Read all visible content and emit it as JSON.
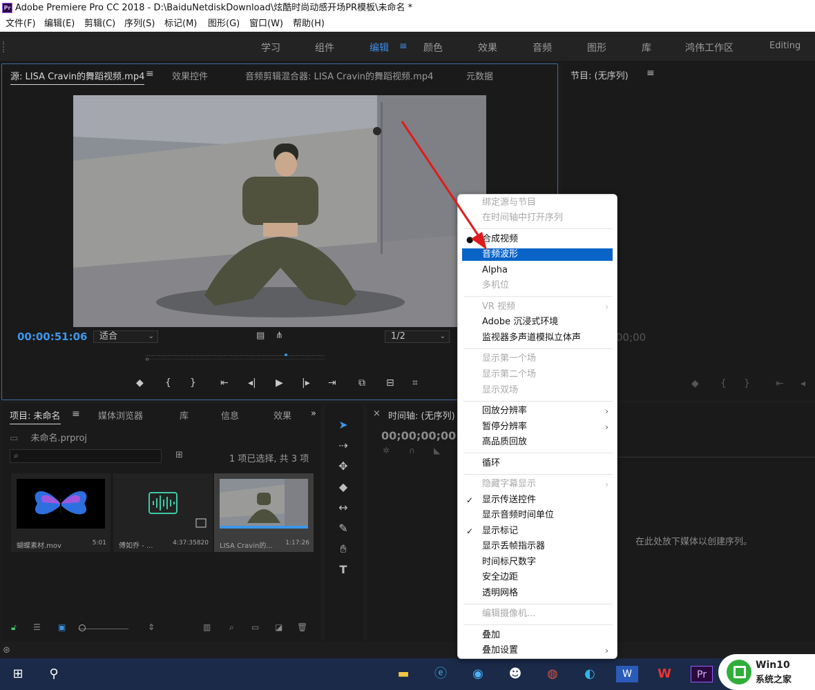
{
  "window": {
    "title": "Adobe Premiere Pro CC 2018 - D:\\BaiduNetdiskDownload\\炫酷时尚动感开场PR模板\\未命名 *"
  },
  "menubar": [
    "文件(F)",
    "编辑(E)",
    "剪辑(C)",
    "序列(S)",
    "标记(M)",
    "图形(G)",
    "窗口(W)",
    "帮助(H)"
  ],
  "workspaces": {
    "items": [
      "学习",
      "组件",
      "编辑",
      "颜色",
      "效果",
      "音频",
      "图形",
      "库",
      "鸿伟工作区",
      "Editing"
    ],
    "active": "编辑",
    "menu_icon": "≡"
  },
  "source_panel": {
    "tabs": [
      "源: LISA Cravin的舞蹈视频.mp4",
      "效果控件",
      "音频剪辑混合器: LISA Cravin的舞蹈视频.mp4",
      "元数据"
    ],
    "menu_icon": "≡",
    "timecode": "00:00:51:06",
    "fit_label": "适合",
    "resolution": "1/2"
  },
  "program_panel": {
    "title": "节目: (无序列)",
    "menu_icon": "≡",
    "timecode": "00;00"
  },
  "project_panel": {
    "tabs": [
      "项目: 未命名",
      "媒体浏览器",
      "库",
      "信息",
      "效果"
    ],
    "menu_icon": "≡",
    "expand_icon": "»",
    "path": "未命名.prproj",
    "selection_count": "1 项已选择, 共 3 项",
    "clips": [
      {
        "name": "蝴蝶素材.mov",
        "duration": "5:01"
      },
      {
        "name": "傅如乔 - ...",
        "duration": "4:37:35820"
      },
      {
        "name": "LISA Cravin的...",
        "duration": "1:17:26"
      }
    ]
  },
  "timeline_panel": {
    "close_icon": "×",
    "title": "时间轴: (无序列)",
    "timecode": "00;00;00;00",
    "drop_hint": "在此处放下媒体以创建序列。"
  },
  "context_menu": {
    "items": [
      {
        "label": "绑定源与节目",
        "disabled": true
      },
      {
        "label": "在时间轴中打开序列",
        "disabled": true
      },
      {
        "separator": true
      },
      {
        "label": "合成视频",
        "bullet": true
      },
      {
        "label": "音频波形",
        "highlight": true
      },
      {
        "label": "Alpha"
      },
      {
        "label": "多机位",
        "disabled": true
      },
      {
        "separator": true
      },
      {
        "label": "VR 视频",
        "disabled": true,
        "submenu": true
      },
      {
        "label": "Adobe 沉浸式环境"
      },
      {
        "label": "监视器多声道模拟立体声"
      },
      {
        "separator": true
      },
      {
        "label": "显示第一个场",
        "disabled": true
      },
      {
        "label": "显示第二个场",
        "disabled": true
      },
      {
        "label": "显示双场",
        "disabled": true
      },
      {
        "separator": true
      },
      {
        "label": "回放分辨率",
        "submenu": true
      },
      {
        "label": "暂停分辨率",
        "submenu": true
      },
      {
        "label": "高品质回放"
      },
      {
        "separator": true
      },
      {
        "label": "循环"
      },
      {
        "separator": true
      },
      {
        "label": "隐藏字幕显示",
        "disabled": true,
        "submenu": true
      },
      {
        "label": "显示传送控件",
        "checked": true
      },
      {
        "label": "显示音频时间单位"
      },
      {
        "label": "显示标记",
        "checked": true
      },
      {
        "label": "显示丢帧指示器"
      },
      {
        "label": "时间标尺数字"
      },
      {
        "label": "安全边距"
      },
      {
        "label": "透明网格"
      },
      {
        "separator": true
      },
      {
        "label": "编辑摄像机...",
        "disabled": true
      },
      {
        "separator": true
      },
      {
        "label": "叠加"
      },
      {
        "label": "叠加设置",
        "submenu": true
      }
    ]
  },
  "watermark": {
    "line1": "Win10",
    "line2": "系统之家"
  },
  "colors": {
    "accent_blue": "#3d96ea",
    "menu_highlight": "#0a64c8",
    "annotation_arrow": "#e01b1b"
  },
  "icons": {
    "transport": [
      "marker-icon",
      "mark-in-icon",
      "mark-out-icon",
      "go-to-in-icon",
      "step-back-icon",
      "play-icon",
      "step-forward-icon",
      "go-to-out-icon",
      "insert-icon",
      "overwrite-icon",
      "export-frame-icon"
    ],
    "tools": [
      "selection-tool-icon",
      "track-select-icon",
      "ripple-edit-icon",
      "razor-icon",
      "slip-icon",
      "pen-icon",
      "hand-icon",
      "type-icon"
    ],
    "taskbar": [
      "windows-start-icon",
      "search-icon",
      "file-explorer-icon",
      "ie-icon",
      "browser-icon",
      "qq-icon",
      "chrome-icon",
      "edge-icon",
      "word-icon",
      "wps-icon",
      "premiere-icon"
    ]
  }
}
